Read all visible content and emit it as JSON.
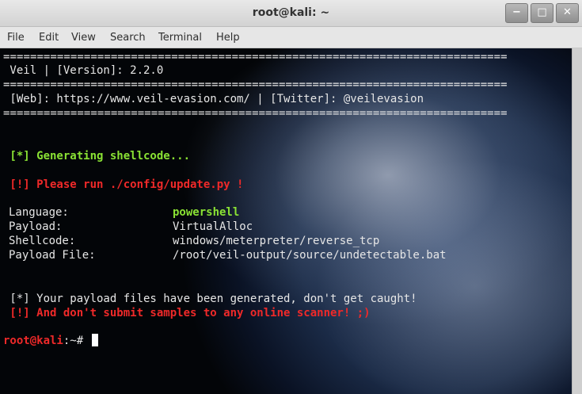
{
  "window": {
    "title": "root@kali: ~",
    "controls": [
      "−",
      "□",
      "✕"
    ]
  },
  "menu": [
    "File",
    "Edit",
    "View",
    "Search",
    "Terminal",
    "Help"
  ],
  "terminal": {
    "separator": "===========================================================================",
    "version_line": " Veil | [Version]: 2.2.0",
    "web_line": " [Web]: https://www.veil-evasion.com/ | [Twitter]: @veilevasion",
    "generating": " [*] Generating shellcode...",
    "update_warning": " [!] Please run ./config/update.py !",
    "details": [
      {
        "label": "Language:",
        "value": "powershell",
        "highlight": true
      },
      {
        "label": "Payload:",
        "value": "VirtualAlloc",
        "highlight": false
      },
      {
        "label": "Shellcode:",
        "value": "windows/meterpreter/reverse_tcp",
        "highlight": false
      },
      {
        "label": "Payload File:",
        "value": "/root/veil-output/source/undetectable.bat",
        "highlight": false
      }
    ],
    "success": " [*] Your payload files have been generated, don't get caught!",
    "warning": " [!] And don't submit samples to any online scanner! ;)",
    "prompt_user": "root@kali",
    "prompt_path": ":~# "
  },
  "colors": {
    "green": "#8ae234",
    "red": "#ef2929",
    "text": "#e6e6e6"
  }
}
